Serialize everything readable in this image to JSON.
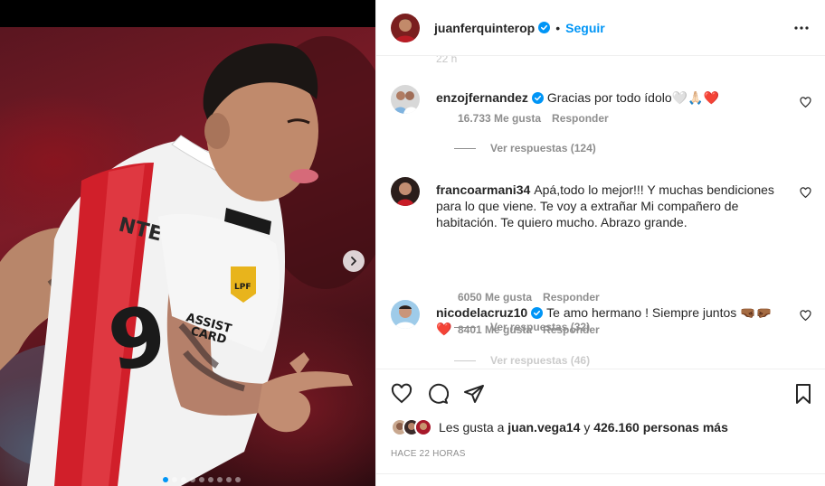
{
  "post": {
    "carousel": {
      "total": 9,
      "active_index": 0
    },
    "header": {
      "username": "juanferquinterop",
      "verified": true,
      "follow_label": "Seguir",
      "more_icon": "more-horizontal-icon"
    },
    "time_stub": "22 h",
    "comments": [
      {
        "username": "enzojfernandez",
        "verified": true,
        "text": "Gracias por todo ídolo🤍🙏🏻❤️",
        "likes": "16.733 Me gusta",
        "reply": "Responder",
        "replies": "Ver respuestas (124)"
      },
      {
        "username": "francoarmani34",
        "verified": false,
        "text": "Apá,todo lo mejor!!! Y muchas bendiciones para lo que viene. Te voy a extrañar Mi compañero de habitación. Te quiero mucho. Abrazo grande.",
        "likes": "6050 Me gusta",
        "reply": "Responder",
        "replies": "Ver respuestas (32)"
      },
      {
        "username": "nicodelacruz10",
        "verified": true,
        "text": "Te amo hermano ! Siempre juntos 🤜🏾🤛🏾❤️",
        "likes": "8401 Me gusta",
        "reply": "Responder",
        "replies": "Ver respuestas (46)"
      }
    ],
    "likes": {
      "prefix": "Les gusta a",
      "user": "juan.vega14",
      "connector": "y",
      "others": "426.160 personas más"
    },
    "timestamp": "HACE 22 HORAS"
  },
  "colors": {
    "accent": "#0095f6",
    "text": "#262626",
    "muted": "#8e8e8e",
    "heart_red": "#ed1c24",
    "border": "#efefef"
  }
}
